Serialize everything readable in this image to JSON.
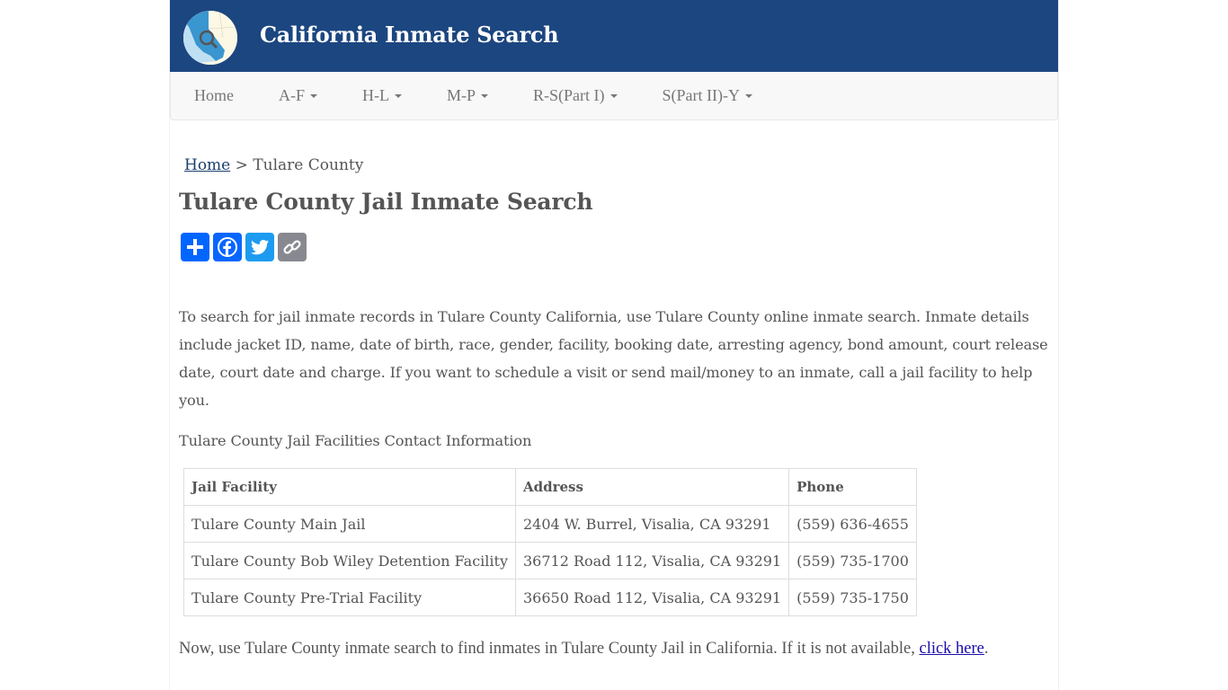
{
  "header": {
    "site_title": "California Inmate Search",
    "logo_icon": "california-map-magnifier-logo",
    "brand_color": "#1c4680"
  },
  "nav": {
    "items": [
      {
        "label": "Home",
        "dropdown": false
      },
      {
        "label": "A-F",
        "dropdown": true
      },
      {
        "label": "H-L",
        "dropdown": true
      },
      {
        "label": "M-P",
        "dropdown": true
      },
      {
        "label": "R-S(Part I)",
        "dropdown": true
      },
      {
        "label": "S(Part II)-Y",
        "dropdown": true
      }
    ]
  },
  "breadcrumb": {
    "home": "Home",
    "separator": ">",
    "current": "Tulare County"
  },
  "page_title": "Tulare County Jail Inmate Search",
  "share": {
    "buttons": [
      {
        "name": "share",
        "icon": "plus-icon",
        "color": "#0166ff"
      },
      {
        "name": "facebook",
        "icon": "facebook-icon",
        "color": "#0866ff"
      },
      {
        "name": "twitter",
        "icon": "twitter-icon",
        "color": "#1d9bf0"
      },
      {
        "name": "copy-link",
        "icon": "link-icon",
        "color": "#888990"
      }
    ]
  },
  "intro_text": "To search for jail inmate records in Tulare County California, use Tulare County online inmate search. Inmate details include jacket ID, name, date of birth, race, gender, facility, booking date, arresting agency, bond amount, court release date, court date and charge. If you want to schedule a visit or send mail/money to an inmate, call a jail facility to help you.",
  "contact_heading": "Tulare County Jail Facilities Contact Information",
  "table": {
    "headers": [
      "Jail Facility",
      "Address",
      "Phone"
    ],
    "rows": [
      [
        "Tulare County Main Jail",
        "2404 W. Burrel, Visalia, CA 93291",
        "(559) 636-4655"
      ],
      [
        "Tulare County Bob Wiley Detention Facility",
        "36712 Road 112, Visalia, CA 93291",
        "(559) 735-1700"
      ],
      [
        "Tulare County Pre-Trial Facility",
        "36650 Road 112, Visalia, CA 93291",
        "(559) 735-1750"
      ]
    ]
  },
  "outro": {
    "text": "Now, use Tulare County inmate search to find inmates in Tulare County Jail in California. If it is not available, ",
    "link": "click here",
    "end": "."
  }
}
